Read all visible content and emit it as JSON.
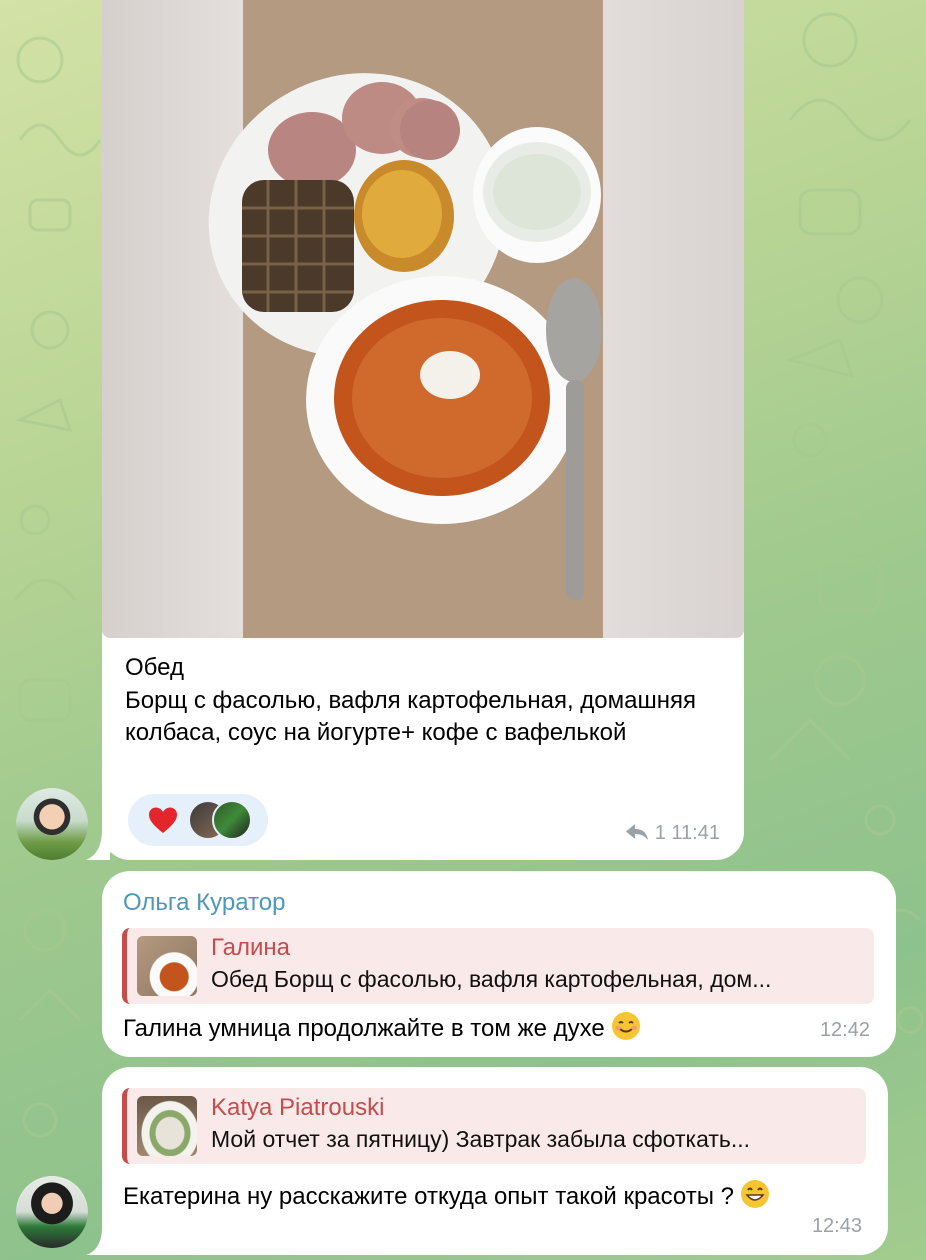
{
  "message1": {
    "caption": "Обед\nБорщ с фасолью, вафля картофельная, домашняя колбаса, соус на йогурте+ кофе с вафелькой",
    "reaction_emoji": "red-heart",
    "reply_count": "1",
    "time": "11:41"
  },
  "message2": {
    "sender": "Ольга Куратор",
    "quote_author": "Галина",
    "quote_text": "Обед  Борщ с фасолью, вафля картофельная, дом...",
    "text": "Галина умница продолжайте в том же духе",
    "emoji": "smiling-face",
    "time": "12:42"
  },
  "message3": {
    "quote_author": "Katya Piatrouski",
    "quote_text": "Мой отчет за пятницу)  Завтрак забыла сфоткать...",
    "text": "Екатерина ну расскажите откуда опыт такой красоты ?",
    "emoji": "grinning-face",
    "time": "12:43"
  },
  "colors": {
    "sender_name": "#4f97b8",
    "quote_accent": "#c64b4b",
    "quote_bg": "#f9e9e9",
    "bubble": "#ffffff",
    "meta": "#9aa1a8"
  }
}
